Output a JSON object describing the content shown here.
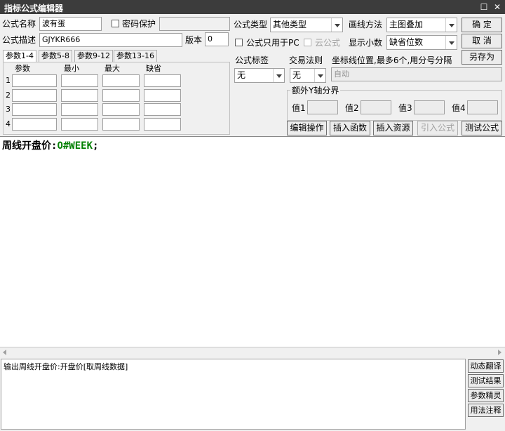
{
  "window": {
    "title": "指标公式编辑器",
    "restore_glyph": "☐",
    "close_glyph": "✕"
  },
  "form": {
    "name_label": "公式名称",
    "name_value": "波有蛋",
    "password_label": "密码保护",
    "desc_label": "公式描述",
    "desc_value": "GJYKR666",
    "version_label": "版本",
    "version_value": "0",
    "type_label": "公式类型",
    "type_value": "其他类型",
    "draw_label": "画线方法",
    "draw_value": "主图叠加",
    "pc_only_label": "公式只用于PC",
    "cloud_label": "云公式",
    "decimals_label": "显示小数",
    "decimals_value": "缺省位数"
  },
  "buttons": {
    "ok": "确 定",
    "cancel": "取 消",
    "save_as": "另存为"
  },
  "tabs": [
    "参数1-4",
    "参数5-8",
    "参数9-12",
    "参数13-16"
  ],
  "params": {
    "headers": [
      "参数",
      "最小",
      "最大",
      "缺省"
    ],
    "rows": [
      "1",
      "2",
      "3",
      "4"
    ]
  },
  "right": {
    "tag_label": "公式标签",
    "tag_value": "无",
    "trade_label": "交易法则",
    "trade_value": "无",
    "coord_label": "坐标线位置,最多6个,用分号分隔",
    "coord_value": "自动",
    "yaxis_label": "额外Y轴分界",
    "val_labels": [
      "值1",
      "值2",
      "值3",
      "值4"
    ]
  },
  "actions": [
    "编辑操作",
    "插入函数",
    "插入资源",
    "引入公式",
    "测试公式"
  ],
  "editor": {
    "name": "周线开盘价",
    "sep": ":",
    "func": "O#WEEK",
    "end": ";"
  },
  "output": "输出周线开盘价:开盘价[取周线数据]",
  "side_buttons": [
    "动态翻译",
    "测试结果",
    "参数精灵",
    "用法注释"
  ],
  "colors": {
    "func": "#008000",
    "titlebar": "#3c3c3c"
  }
}
